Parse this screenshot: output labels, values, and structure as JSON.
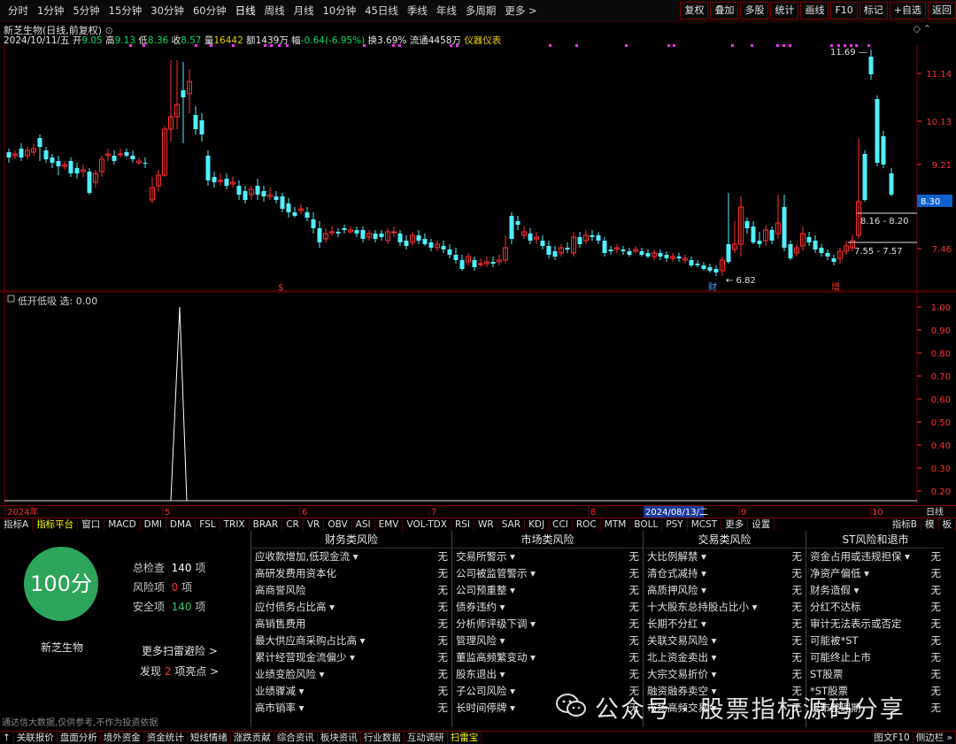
{
  "toolbar": {
    "periods": [
      "分时",
      "1分钟",
      "5分钟",
      "15分钟",
      "30分钟",
      "60分钟",
      "日线",
      "周线",
      "月线",
      "10分钟",
      "45日线",
      "季线",
      "年线",
      "多周期",
      "更多 >"
    ],
    "active_period": "日线",
    "right_buttons": [
      "复权",
      "叠加",
      "多股",
      "统计",
      "画线",
      "F10",
      "标记",
      "+自选",
      "返回"
    ]
  },
  "header": {
    "title": "新芝生物(日线,前复权)",
    "date": "2024/10/11/五",
    "open_label": "开",
    "open": "9.05",
    "high_label": "高",
    "high": "9.13",
    "low_label": "低",
    "low": "8.36",
    "close_label": "收",
    "close": "8.57",
    "vol_label": "量",
    "vol": "16442",
    "amt_label": "额",
    "amt": "1439万",
    "chg_label": "幅",
    "chg": "-0.64(-6.95%)",
    "turn_label": "换",
    "turn": "3.69%",
    "float_label": "流通",
    "float": "4458万",
    "industry": "仪器仪表"
  },
  "main_axis": [
    "11.14",
    "10.13",
    "9.21",
    "8.30",
    "7.46"
  ],
  "price_badge": "8.30",
  "annotations": {
    "high_label": "11.69",
    "low_label": "6.82",
    "zone1": "8.16 - 8.20",
    "zone2": "7.55 - 7.57",
    "marker_s": "$",
    "marker_cai": "财",
    "marker_zeng": "增"
  },
  "indicator": {
    "label": "低开低吸 选: 0.00",
    "axis": [
      "1.00",
      "0.90",
      "0.80",
      "0.70",
      "0.60",
      "0.50",
      "0.40",
      "0.30",
      "0.20"
    ]
  },
  "datebar": {
    "labels": [
      "2024年",
      "5",
      "6",
      "7",
      "8",
      "9",
      "10"
    ],
    "highlight": "2024/08/13/二",
    "right": "日线"
  },
  "tabs": [
    "指标A",
    "指标平台",
    "窗口",
    "MACD",
    "DMI",
    "DMA",
    "FSL",
    "TRIX",
    "BRAR",
    "CR",
    "VR",
    "OBV",
    "ASI",
    "EMV",
    "VOL-TDX",
    "RSI",
    "WR",
    "SAR",
    "KDJ",
    "CCI",
    "ROC",
    "MTM",
    "BOLL",
    "PSY",
    "MCST",
    "更多",
    "设置"
  ],
  "tabs_right": [
    "指标B",
    "模",
    "板"
  ],
  "scan": {
    "score": "100分",
    "stock_name": "新芝生物",
    "total_label": "总检查",
    "total": "140",
    "total_unit": "项",
    "risk_label": "风险项",
    "risk": "0",
    "risk_unit": "项",
    "safe_label": "安全项",
    "safe": "140",
    "safe_unit": "项",
    "more": "更多扫雷避险 >",
    "find_pre": "发现",
    "find_num": "2",
    "find_post": "项亮点 >",
    "disclaimer": "通达信大数据,仅供参考,不作为投资依据"
  },
  "columns": [
    {
      "title": "财务类风险",
      "rows": [
        [
          "应收款增加,低现金流 ▾",
          "无"
        ],
        [
          "高研发费用资本化",
          "无"
        ],
        [
          "高商誉风险",
          "无"
        ],
        [
          "应付债务占比高 ▾",
          "无"
        ],
        [
          "高销售费用",
          "无"
        ],
        [
          "最大供应商采购占比高 ▾",
          "无"
        ],
        [
          "累计经营现金流偏少 ▾",
          "无"
        ],
        [
          "业绩变脸风险 ▾",
          "无"
        ],
        [
          "业绩骤减 ▾",
          "无"
        ],
        [
          "高市销率 ▾",
          "无"
        ]
      ]
    },
    {
      "title": "市场类风险",
      "rows": [
        [
          "交易所警示 ▾",
          "无"
        ],
        [
          "公司被监管警示 ▾",
          "无"
        ],
        [
          "公司预重整 ▾",
          "无"
        ],
        [
          "债券违约 ▾",
          "无"
        ],
        [
          "分析师评级下调 ▾",
          "无"
        ],
        [
          "管理风险 ▾",
          "无"
        ],
        [
          "董监高频繁变动 ▾",
          "无"
        ],
        [
          "股东退出 ▾",
          "无"
        ],
        [
          "子公司风险 ▾",
          "无"
        ],
        [
          "长时间停牌 ▾",
          "无"
        ]
      ]
    },
    {
      "title": "交易类风险",
      "rows": [
        [
          "大比例解禁 ▾",
          "无"
        ],
        [
          "清仓式减持 ▾",
          "无"
        ],
        [
          "高质押风险 ▾",
          "无"
        ],
        [
          "十大股东总持股占比小 ▾",
          "无"
        ],
        [
          "长期不分红 ▾",
          "无"
        ],
        [
          "关联交易风险 ▾",
          "无"
        ],
        [
          "北上资金卖出 ▾",
          "无"
        ],
        [
          "大宗交易折价 ▾",
          "无"
        ],
        [
          "融资融券卖空 ▾",
          "无"
        ],
        [
          "市场高频交易 ▾",
          "无"
        ]
      ]
    },
    {
      "title": "ST风险和退市",
      "rows": [
        [
          "资金占用或违规担保 ▾",
          "无"
        ],
        [
          "净资产偏低 ▾",
          "无"
        ],
        [
          "财务造假 ▾",
          "无"
        ],
        [
          "分红不达标",
          "无"
        ],
        [
          "审计无法表示或否定",
          "无"
        ],
        [
          "可能被*ST",
          "无"
        ],
        [
          "可能终止上市",
          "无"
        ],
        [
          "ST股票",
          "无"
        ],
        [
          "*ST股票",
          "无"
        ],
        [
          "退市整理期",
          "无"
        ]
      ]
    }
  ],
  "bottom": [
    "↑",
    "关联报价",
    "盘面分析",
    "境外资金",
    "资金统计",
    "短线情绪",
    "涨跌贡献",
    "综合资讯",
    "板块资讯",
    "行业数据",
    "互动调研",
    "扫雷宝"
  ],
  "bottom_right": [
    "图文F10",
    "侧边栏 »"
  ],
  "watermark": "公众号 · 股票指标源码分享"
}
